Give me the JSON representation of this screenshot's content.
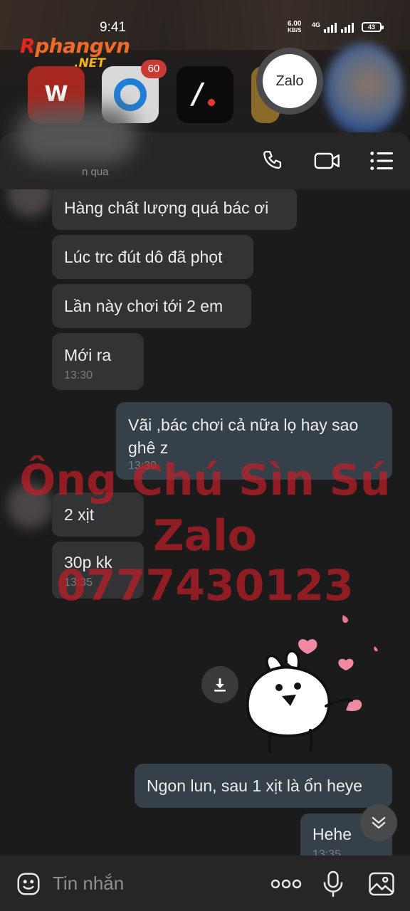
{
  "status_bar": {
    "time": "9:41",
    "net_speed": "6.00",
    "net_unit": "KB/S",
    "network": "4G",
    "battery": "43"
  },
  "watermark_logo": {
    "name_r": "R",
    "name_rest": "phangvn",
    "domain": ".NET"
  },
  "launcher": {
    "badge_count": "60",
    "zalo_label": "Zalo"
  },
  "header": {
    "subtitle": "n qua",
    "icons": [
      "phone-icon",
      "video-call-icon",
      "menu-list-icon"
    ]
  },
  "messages": [
    {
      "dir": "in",
      "text": "Hàng chất lượng quá bác ơi"
    },
    {
      "dir": "in",
      "text": "Lúc trc đút dô đã phọt"
    },
    {
      "dir": "in",
      "text": "Lần này chơi tới 2 em"
    },
    {
      "dir": "in",
      "text": "Mới ra",
      "time": "13:30"
    },
    {
      "dir": "out",
      "text": "Vãi ,bác chơi cả nữa lọ hay sao ghê z",
      "time": "13:30"
    },
    {
      "dir": "in",
      "text": "2 xịt"
    },
    {
      "dir": "in",
      "text": "30p kk",
      "time": "13:35"
    },
    {
      "dir": "out",
      "text": "Ngon lun, sau 1 xịt là ổn heye"
    },
    {
      "dir": "out",
      "text": "Hehe",
      "time": "13:35"
    }
  ],
  "overlay_watermark": {
    "line1": "Ông Chú Sìn Sú",
    "line2": "Zalo 0777430123"
  },
  "input": {
    "placeholder": "Tin nhắn",
    "icons": [
      "sticker-icon",
      "more-icon",
      "microphone-icon",
      "image-icon"
    ]
  },
  "colors": {
    "background": "#1b1b1c",
    "incoming_bubble": "#333335",
    "outgoing_bubble": "#364049",
    "watermark": "#be1e28"
  }
}
